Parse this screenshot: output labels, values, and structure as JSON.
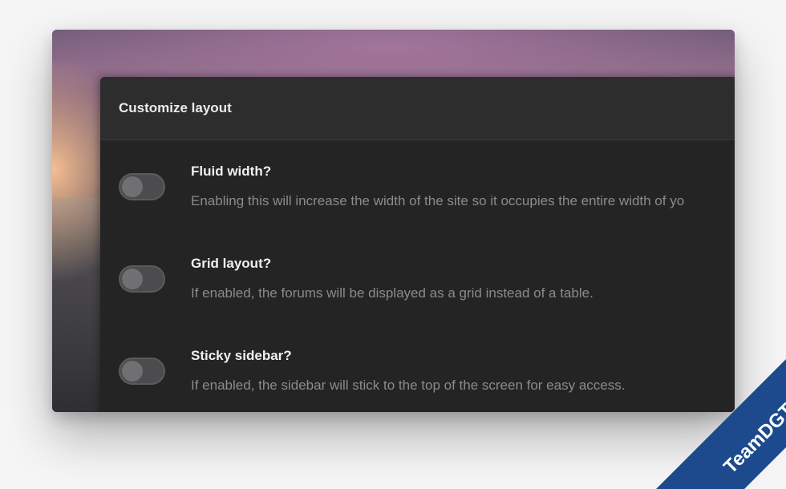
{
  "panel": {
    "title": "Customize layout"
  },
  "options": [
    {
      "title": "Fluid width?",
      "description": "Enabling this will increase the width of the site so it occupies the entire width of yo",
      "enabled": false
    },
    {
      "title": "Grid layout?",
      "description": "If enabled, the forums will be displayed as a grid instead of a table.",
      "enabled": false
    },
    {
      "title": "Sticky sidebar?",
      "description": "If enabled, the sidebar will stick to the top of the screen for easy access.",
      "enabled": false
    }
  ],
  "watermark": {
    "text": "TeamDGT.org",
    "color": "#1c4a8c"
  },
  "colors": {
    "panel_bg": "#242425",
    "header_bg": "#2d2d2e",
    "toggle_off": "#4c4c4f"
  }
}
